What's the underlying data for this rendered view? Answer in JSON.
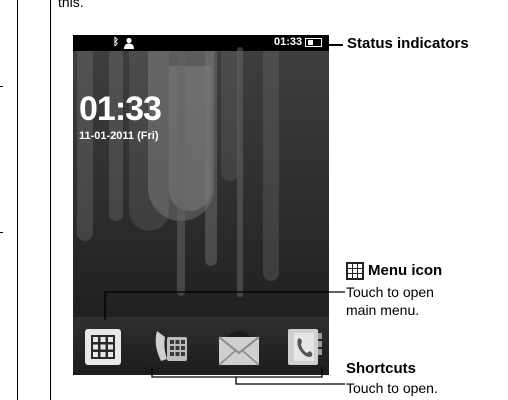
{
  "top_fragment": "this.",
  "phone": {
    "status_time": "01:33",
    "clock_time": "01:33",
    "clock_date": "11-01-2011 (Fri)"
  },
  "icons": {
    "bluetooth": "bluetooth-icon",
    "contact": "person-icon",
    "battery": "battery-icon",
    "menu": "grid-menu-icon",
    "phone": "phone-icon",
    "messages": "envelope-icon",
    "contacts": "contacts-book-icon"
  },
  "annotations": {
    "status": "Status indicators",
    "menu_title": "Menu icon",
    "menu_desc_1": "Touch to open",
    "menu_desc_2": "main menu.",
    "shortcuts_title": "Shortcuts",
    "shortcuts_desc": "Touch to open."
  }
}
